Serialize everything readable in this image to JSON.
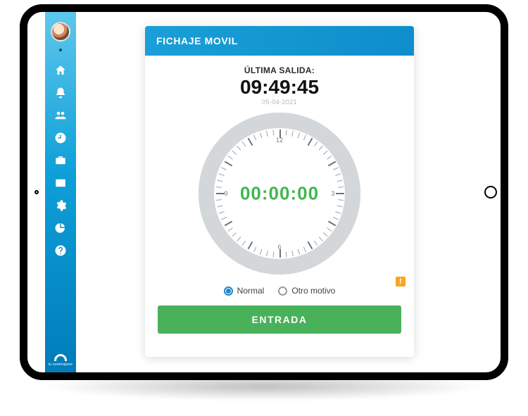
{
  "sidebar": {
    "brand_text": "tu nominapree",
    "items": [
      {
        "name": "home",
        "icon": "home-icon"
      },
      {
        "name": "alerts",
        "icon": "bell-icon"
      },
      {
        "name": "team",
        "icon": "people-icon"
      },
      {
        "name": "time",
        "icon": "clock-icon"
      },
      {
        "name": "briefcase",
        "icon": "briefcase-icon"
      },
      {
        "name": "profile",
        "icon": "idcard-icon"
      },
      {
        "name": "settings",
        "icon": "gear-icon"
      },
      {
        "name": "reports",
        "icon": "piechart-icon"
      },
      {
        "name": "help",
        "icon": "help-icon"
      }
    ]
  },
  "card": {
    "title": "FICHAJE MOVIL",
    "last_label": "ÚLTIMA SALIDA:",
    "last_time": "09:49:45",
    "last_date": "05-04-2021",
    "elapsed": "00:00:00",
    "clock_numbers": {
      "top": "12",
      "right": "3",
      "bottom": "6",
      "left": "9"
    },
    "radios": {
      "normal": "Normal",
      "other": "Otro motivo",
      "selected": "normal"
    },
    "entry_button": "ENTRADA",
    "flag": "!"
  }
}
